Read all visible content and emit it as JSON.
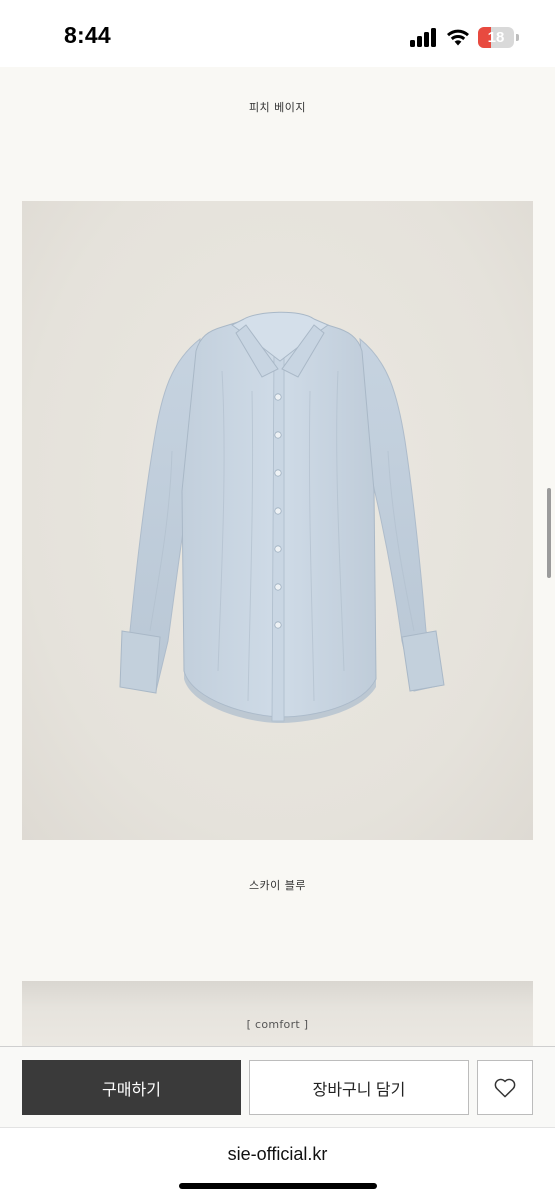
{
  "status_bar": {
    "time": "8:44",
    "battery": "18",
    "icons": [
      "signal-icon",
      "wifi-icon",
      "battery-icon"
    ]
  },
  "product": {
    "color_label_top": "피치 베이지",
    "color_label_bottom": "스카이 블루",
    "section_label": "[ comfort ]",
    "photo": "light-blue-shirt-photo"
  },
  "actions": {
    "buy_label": "구매하기",
    "cart_label": "장바구니 담기",
    "wish_icon": "heart-icon"
  },
  "browser": {
    "url": "sie-official.kr"
  },
  "colors": {
    "background": "#f9f8f4",
    "buy_button": "#3a3a3a",
    "shirt": "#c9d6e3",
    "battery_low": "#e84a3f"
  }
}
